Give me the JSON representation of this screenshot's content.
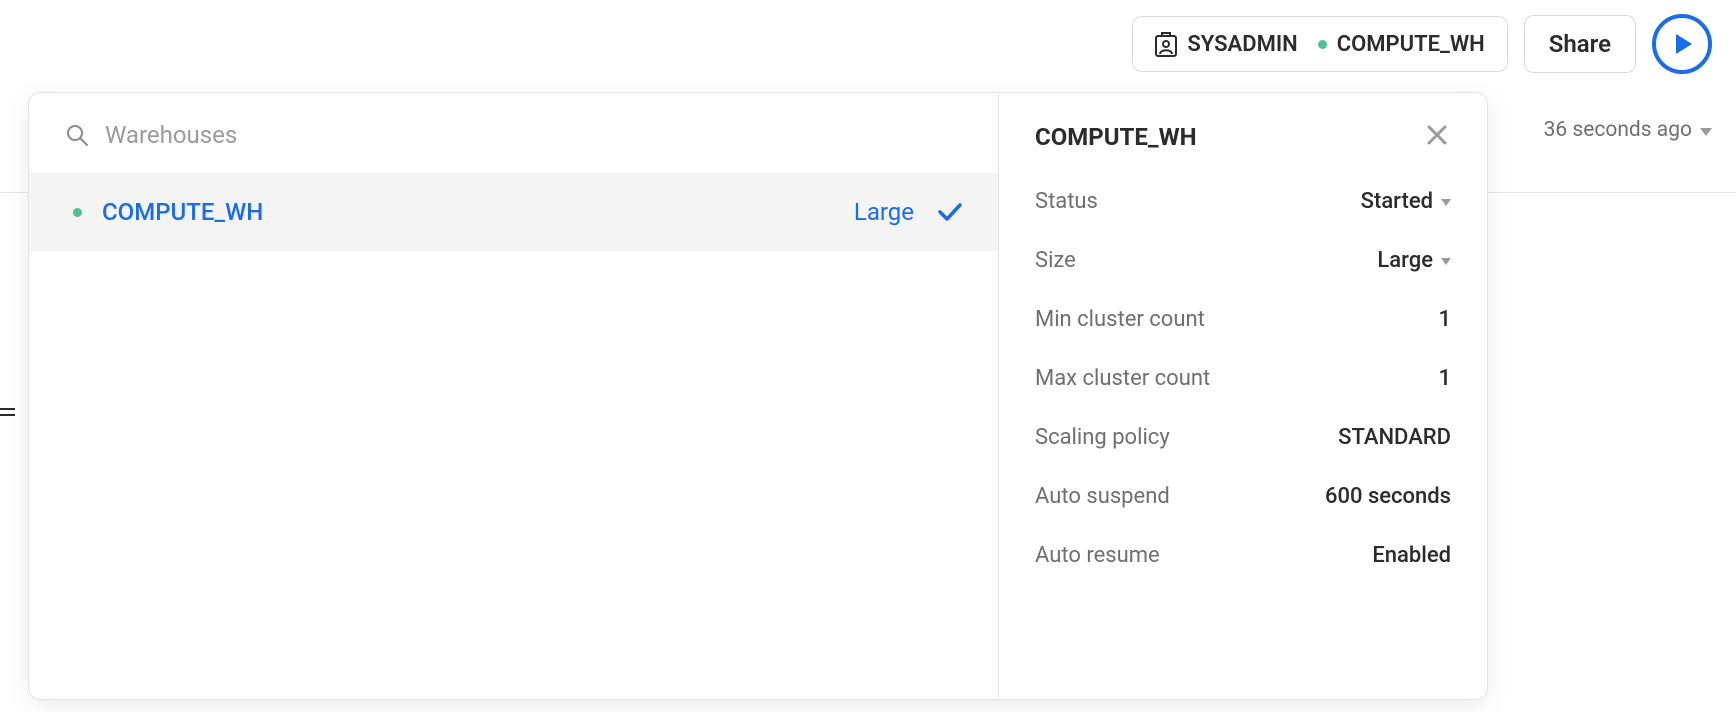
{
  "toolbar": {
    "role": "SYSADMIN",
    "warehouse": "COMPUTE_WH",
    "share_label": "Share"
  },
  "timestamp": "36 seconds ago",
  "search": {
    "placeholder": "Warehouses"
  },
  "list": {
    "items": [
      {
        "name": "COMPUTE_WH",
        "size": "Large",
        "selected": true
      }
    ]
  },
  "details": {
    "title": "COMPUTE_WH",
    "rows": {
      "status": {
        "label": "Status",
        "value": "Started",
        "dropdown": true
      },
      "size": {
        "label": "Size",
        "value": "Large",
        "dropdown": true
      },
      "min_cluster": {
        "label": "Min cluster count",
        "value": "1",
        "dropdown": false
      },
      "max_cluster": {
        "label": "Max cluster count",
        "value": "1",
        "dropdown": false
      },
      "scaling": {
        "label": "Scaling policy",
        "value": "STANDARD",
        "dropdown": false
      },
      "auto_suspend": {
        "label": "Auto suspend",
        "value": "600 seconds",
        "dropdown": false
      },
      "auto_resume": {
        "label": "Auto resume",
        "value": "Enabled",
        "dropdown": false
      }
    }
  }
}
